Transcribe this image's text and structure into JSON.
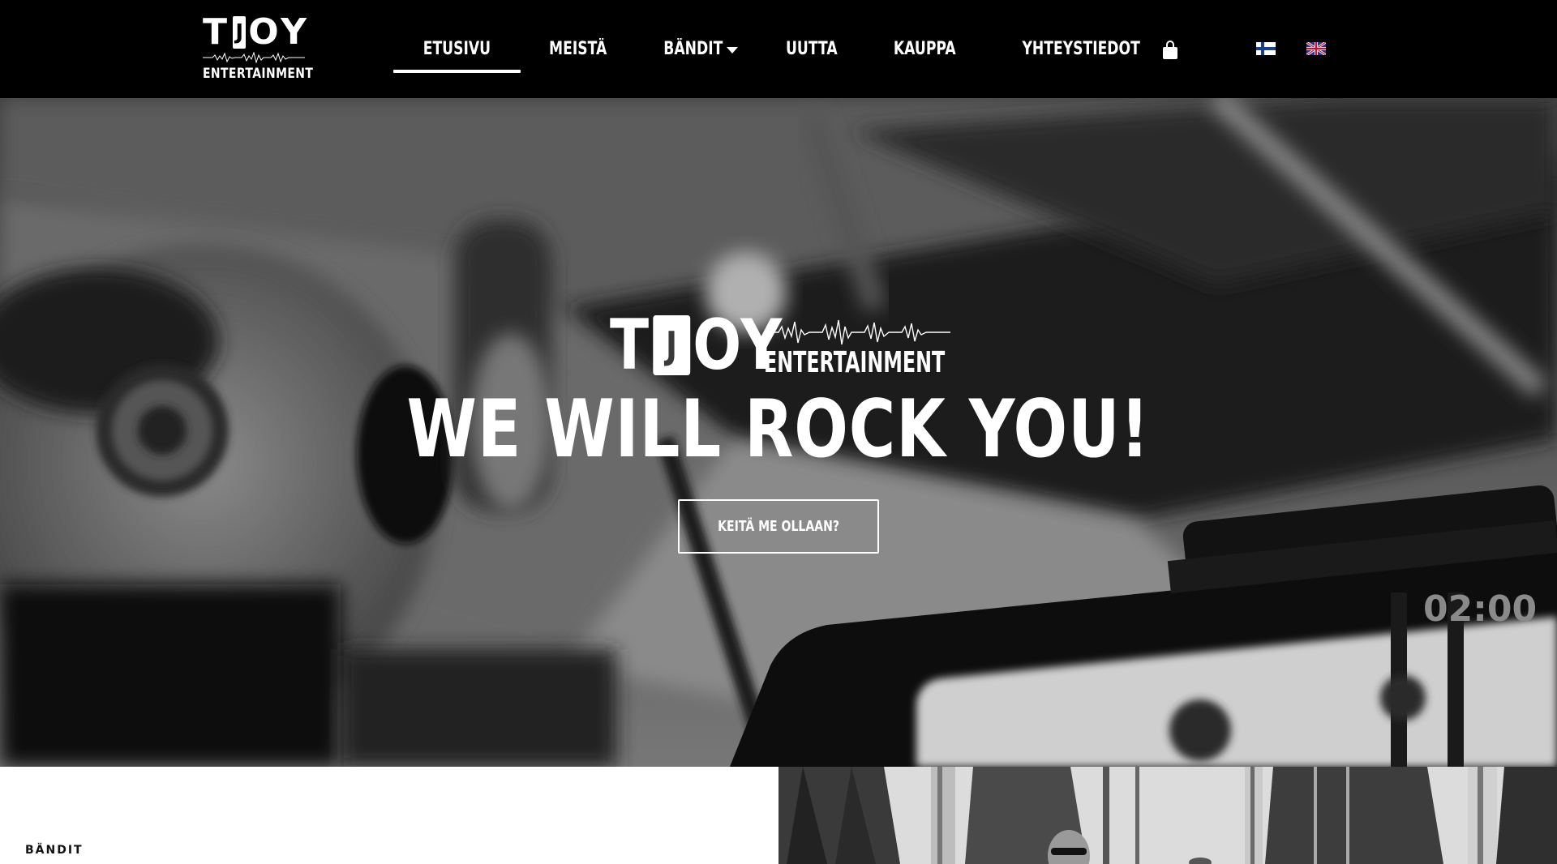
{
  "header": {
    "logo": {
      "top_letters_left": "T",
      "top_letter_box": "J",
      "top_letters_right": "OY",
      "sub": "ENTERTAINMENT"
    },
    "nav": [
      {
        "label": "ETUSIVU",
        "active": true
      },
      {
        "label": "MEISTÄ",
        "active": false
      },
      {
        "label": "BÄNDIT",
        "active": false,
        "has_dropdown": true
      },
      {
        "label": "UUTTA",
        "active": false
      },
      {
        "label": "KAUPPA",
        "active": false
      },
      {
        "label": "YHTEYSTIEDOT",
        "active": false
      }
    ],
    "cart_icon": "shopping-bag-icon",
    "languages": [
      "fi",
      "en"
    ]
  },
  "hero": {
    "logo": {
      "letters_left": "T",
      "letter_box": "J",
      "letters_right": "OY",
      "sub": "ENTERTAINMENT"
    },
    "title": "WE WILL ROCK YOU!",
    "button_label": "KEITÄ ME OLLAAN?",
    "background_text": "02:00"
  },
  "bands_section": {
    "label": "BÄNDIT"
  },
  "colors": {
    "header_bg": "#000000",
    "text": "#ffffff",
    "section_bg": "#ffffff"
  }
}
